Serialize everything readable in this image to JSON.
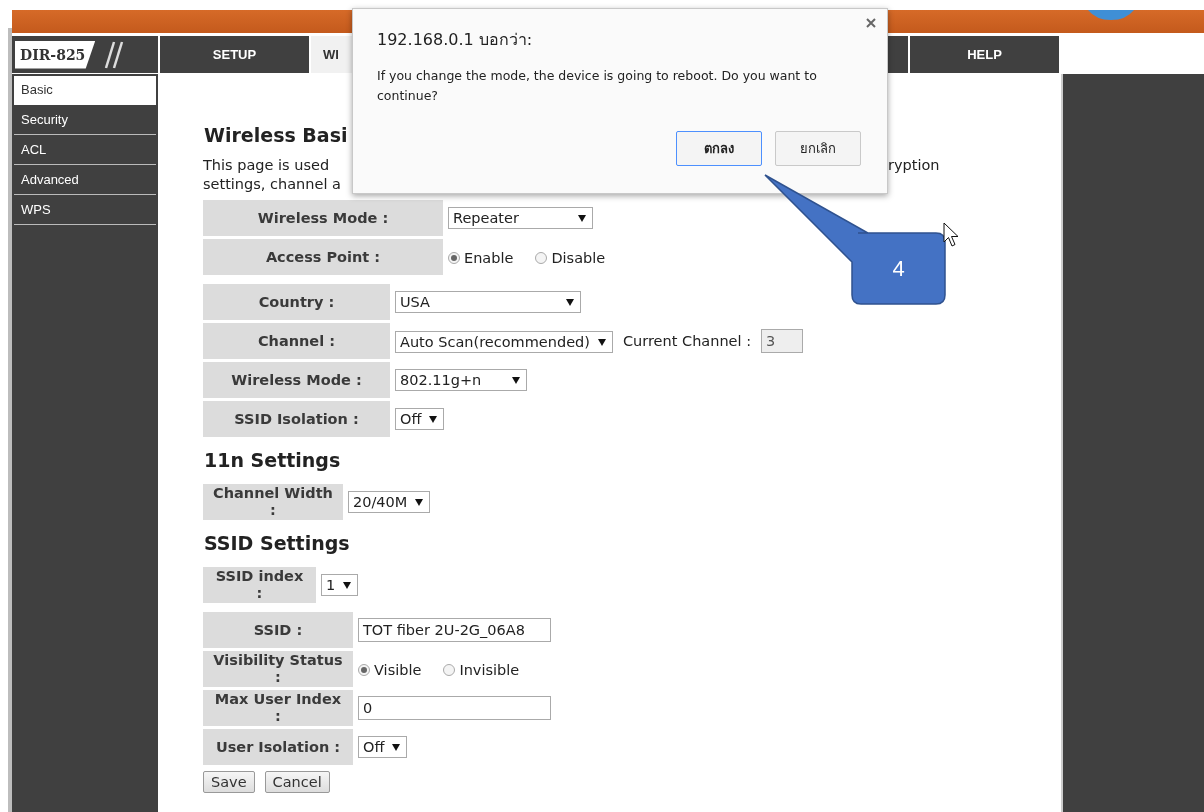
{
  "header": {
    "model": "DIR-825"
  },
  "tabs": [
    {
      "label": "SETUP",
      "selected": false
    },
    {
      "label": "WI",
      "selected": true
    },
    {
      "label": "HELP",
      "selected": false
    }
  ],
  "sidebar": {
    "items": [
      {
        "label": "Basic",
        "selected": true
      },
      {
        "label": "Security",
        "selected": false
      },
      {
        "label": "ACL",
        "selected": false
      },
      {
        "label": "Advanced",
        "selected": false
      },
      {
        "label": "WPS",
        "selected": false
      }
    ]
  },
  "sections": [
    {
      "heading": "Wireless Basi",
      "intro": [
        "This page is used",
        "ryption",
        "settings, channel a"
      ],
      "tables": [
        [
          {
            "label": "Wireless Mode :",
            "kind": "select",
            "value": "Repeater"
          },
          {
            "label": "Access Point :",
            "kind": "radio",
            "options": [
              {
                "label": "Enable",
                "selected": true
              },
              {
                "label": "Disable",
                "selected": false
              }
            ]
          }
        ],
        [
          {
            "label": "Country :",
            "kind": "select",
            "value": "USA"
          },
          {
            "label": "Channel :",
            "kind": "select_reading",
            "value": "Auto Scan(recommended)",
            "reading_label": "Current Channel :",
            "reading": "3"
          },
          {
            "label": "Wireless Mode :",
            "kind": "select",
            "value": "802.11g+n"
          },
          {
            "label": "SSID Isolation :",
            "kind": "select",
            "value": "Off"
          }
        ]
      ]
    },
    {
      "heading": "11n Settings",
      "tables": [
        [
          {
            "label": "Channel Width\n:",
            "kind": "select",
            "value": "20/40M"
          }
        ]
      ]
    },
    {
      "heading": "SSID Settings",
      "tables": [
        [
          {
            "label": "SSID index\n:",
            "kind": "select",
            "value": "1"
          }
        ],
        [
          {
            "label": "SSID :",
            "kind": "text",
            "value": "TOT fiber 2U-2G_06A8"
          },
          {
            "label": "Visibility Status\n:",
            "kind": "radio",
            "options": [
              {
                "label": "Visible",
                "selected": true
              },
              {
                "label": "Invisible",
                "selected": false
              }
            ]
          },
          {
            "label": "Max User Index\n:",
            "kind": "text",
            "value": "0"
          },
          {
            "label": "User Isolation :",
            "kind": "select",
            "value": "Off"
          }
        ]
      ]
    }
  ],
  "buttons": [
    "Save",
    "Cancel"
  ],
  "dialog": {
    "title": "192.168.0.1 บอกว่า:",
    "message": "If you change the mode, the device is going to reboot. Do you want to continue?",
    "buttons": [
      {
        "label": "ตกลง",
        "selected": true
      },
      {
        "label": "ยกเลิก",
        "selected": false
      }
    ]
  },
  "callout": {
    "label": "4"
  }
}
